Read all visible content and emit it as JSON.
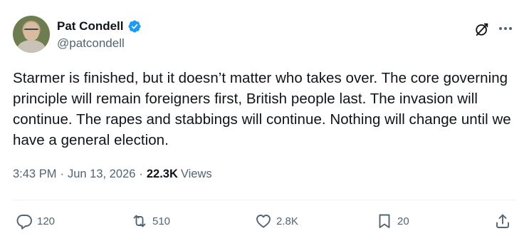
{
  "author": {
    "display_name": "Pat Condell",
    "handle": "@patcondell",
    "verified": true
  },
  "tweet": {
    "text": "Starmer is finished, but it doesn’t matter who takes over. The core governing principle will remain foreigners first, British people last. The invasion will continue. The rapes and stabbings will continue. Nothing will change until we have a general election.",
    "time": "3:43 PM",
    "date": "Jun 13, 2026",
    "separator": "·",
    "views_count": "22.3K",
    "views_label": "Views"
  },
  "actions": {
    "reply_count": "120",
    "repost_count": "510",
    "like_count": "2.8K",
    "bookmark_count": "20"
  },
  "icons": [
    "verified-badge-icon",
    "grok-icon",
    "more-icon",
    "reply-icon",
    "repost-icon",
    "like-icon",
    "bookmark-icon",
    "share-icon"
  ],
  "colors": {
    "text_primary": "#0f1419",
    "text_secondary": "#536471",
    "verified_blue": "#1d9bf0",
    "divider": "#eff3f4"
  }
}
